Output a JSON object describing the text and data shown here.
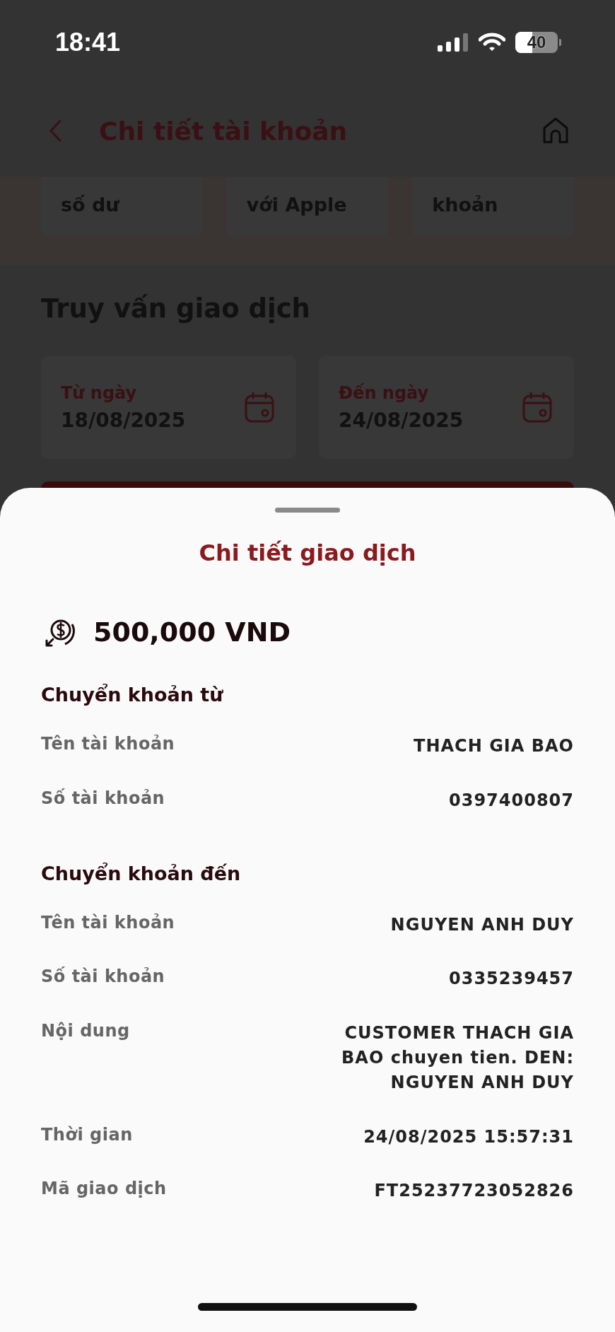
{
  "status_bar": {
    "time": "18:41",
    "battery": "40"
  },
  "header": {
    "title": "Chi tiết tài khoản"
  },
  "quick_actions": [
    {
      "label": "số dư"
    },
    {
      "label": "với Apple"
    },
    {
      "label": "khoản"
    }
  ],
  "query": {
    "title": "Truy vấn giao dịch",
    "fields": [
      {
        "label": "Từ ngày",
        "value": "18/08/2025"
      },
      {
        "label": "Đến ngày",
        "value": "24/08/2025"
      }
    ]
  },
  "sheet": {
    "title": "Chi tiết giao dịch",
    "amount": "500,000 VND",
    "sections": [
      {
        "title": "Chuyển khoản từ",
        "rows": [
          {
            "label": "Tên tài khoản",
            "value": "THACH GIA BAO"
          },
          {
            "label": "Số tài khoản",
            "value": "0397400807"
          }
        ]
      },
      {
        "title": "Chuyển khoản đến",
        "rows": [
          {
            "label": "Tên tài khoản",
            "value": "NGUYEN ANH DUY"
          },
          {
            "label": "Số tài khoản",
            "value": "0335239457"
          },
          {
            "label": "Nội dung",
            "value": "CUSTOMER THACH GIA BAO chuyen tien. DEN: NGUYEN ANH DUY"
          },
          {
            "label": "Thời gian",
            "value": "24/08/2025 15:57:31"
          },
          {
            "label": "Mã giao dịch",
            "value": "FT25237723052826"
          }
        ]
      }
    ]
  }
}
